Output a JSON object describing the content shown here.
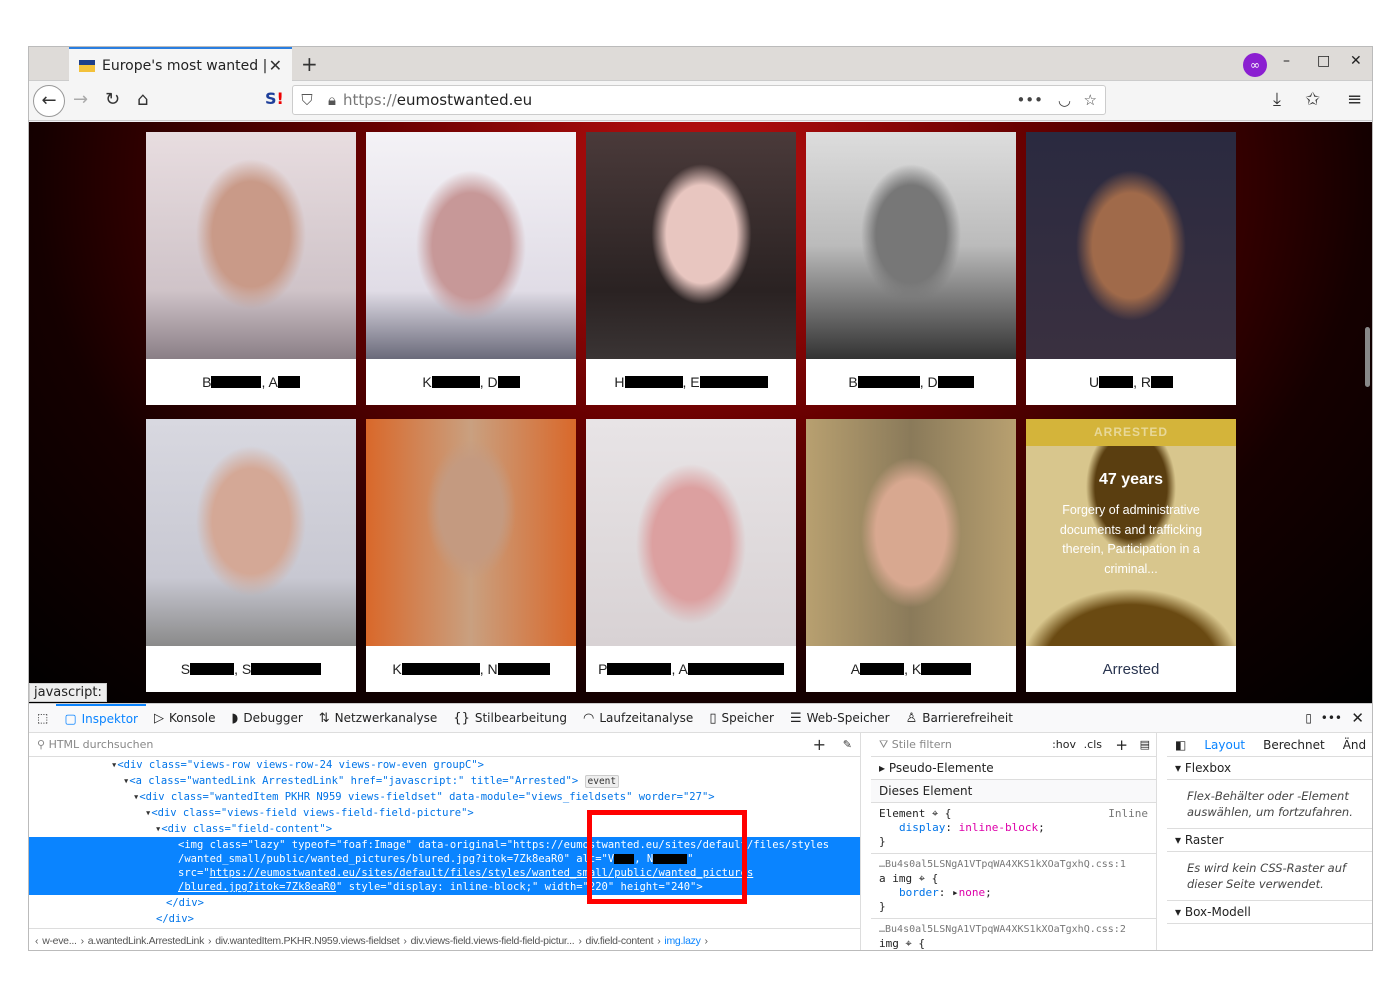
{
  "browser": {
    "tab_title": "Europe's most wanted |",
    "url_prefix": "https://",
    "url_host": "eumostwanted.eu",
    "status_text": "javascript:"
  },
  "cards": [
    {
      "first": "B",
      "second": "A"
    },
    {
      "first": "K",
      "second": "D"
    },
    {
      "first": "H",
      "second": "E"
    },
    {
      "first": "B",
      "second": "D"
    },
    {
      "first": "U",
      "second": "R"
    },
    {
      "first": "S",
      "second": "S"
    },
    {
      "first": "K",
      "second": "N"
    },
    {
      "first": "P",
      "second": "A"
    },
    {
      "first": "A",
      "second": "K"
    }
  ],
  "arrested_card": {
    "badge": "ARRESTED",
    "age": "47 years",
    "description": "Forgery of administrative documents and trafficking therein, Participation in a criminal...",
    "label": "Arrested"
  },
  "devtools": {
    "tabs": [
      "Inspektor",
      "Konsole",
      "Debugger",
      "Netzwerkanalyse",
      "Stilbearbeitung",
      "Laufzeitanalyse",
      "Speicher",
      "Web-Speicher",
      "Barrierefreiheit"
    ],
    "search_placeholder": "HTML durchsuchen",
    "html": {
      "l1": "<div class=\"views-row views-row-24 views-row-even groupC\">",
      "l2": "<a class=\"wantedLink ArrestedLink\" href=\"javascript:\" title=\"Arrested\">",
      "event": "event",
      "l3": "<div class=\"wantedItem PKHR N959 views-fieldset\" data-module=\"views_fieldsets\" worder=\"27\">",
      "l4": "<div class=\"views-field views-field-field-picture\">",
      "l5": "<div class=\"field-content\">",
      "s1": "<img class=\"lazy\" typeof=\"foaf:Image\" data-original=\"https://eumostwanted.eu/sites/default/files/styles",
      "s2": "/wanted_small/public/wanted_pictures/blured.jpg?itok=7Zk8eaR0\" alt=\"V",
      "s2b": ", N",
      "s2c": "\"",
      "s3a": "src=\"",
      "s3": "https://eumostwanted.eu/sites/default/files/styles/wanted_small/public/wanted_pictures",
      "s4": "/blured.jpg?itok=7Zk8eaR0",
      "s4b": "\" style=\"display: inline-block;\" width=\"220\" height=\"240\">",
      "c1": "</div>",
      "c2": "</div>"
    },
    "breadcrumbs": [
      "w-eve...",
      "a.wantedLink.ArrestedLink",
      "div.wantedItem.PKHR.N959.views-fieldset",
      "div.views-field.views-field-field-pictur...",
      "div.field-content",
      "img.lazy"
    ],
    "rules": {
      "filter_placeholder": "Stile filtern",
      "hov": ":hov",
      "cls": ".cls",
      "pseudo": "Pseudo-Elemente",
      "this_element": "Dieses Element",
      "element_sel": "Element",
      "inline": "Inline",
      "prop1": "display",
      "val1": "inline-block",
      "src1": "…Bu4s0al5LSNgA1VTpqWA4XKS1kXOaTgxhQ.css:1",
      "sel2": "a img",
      "prop2": "border",
      "val2": "none",
      "src2": "…Bu4s0al5LSNgA1VTpqWA4XKS1kXOaTgxhQ.css:2",
      "sel3": "img"
    },
    "layout": {
      "tabs": [
        "Layout",
        "Berechnet",
        "Änd"
      ],
      "flexbox": "Flexbox",
      "flex_msg": "Flex-Behälter oder -Element auswählen, um fortzufahren.",
      "grid": "Raster",
      "grid_msg": "Es wird kein CSS-Raster auf dieser Seite verwendet.",
      "box": "Box-Modell"
    }
  }
}
